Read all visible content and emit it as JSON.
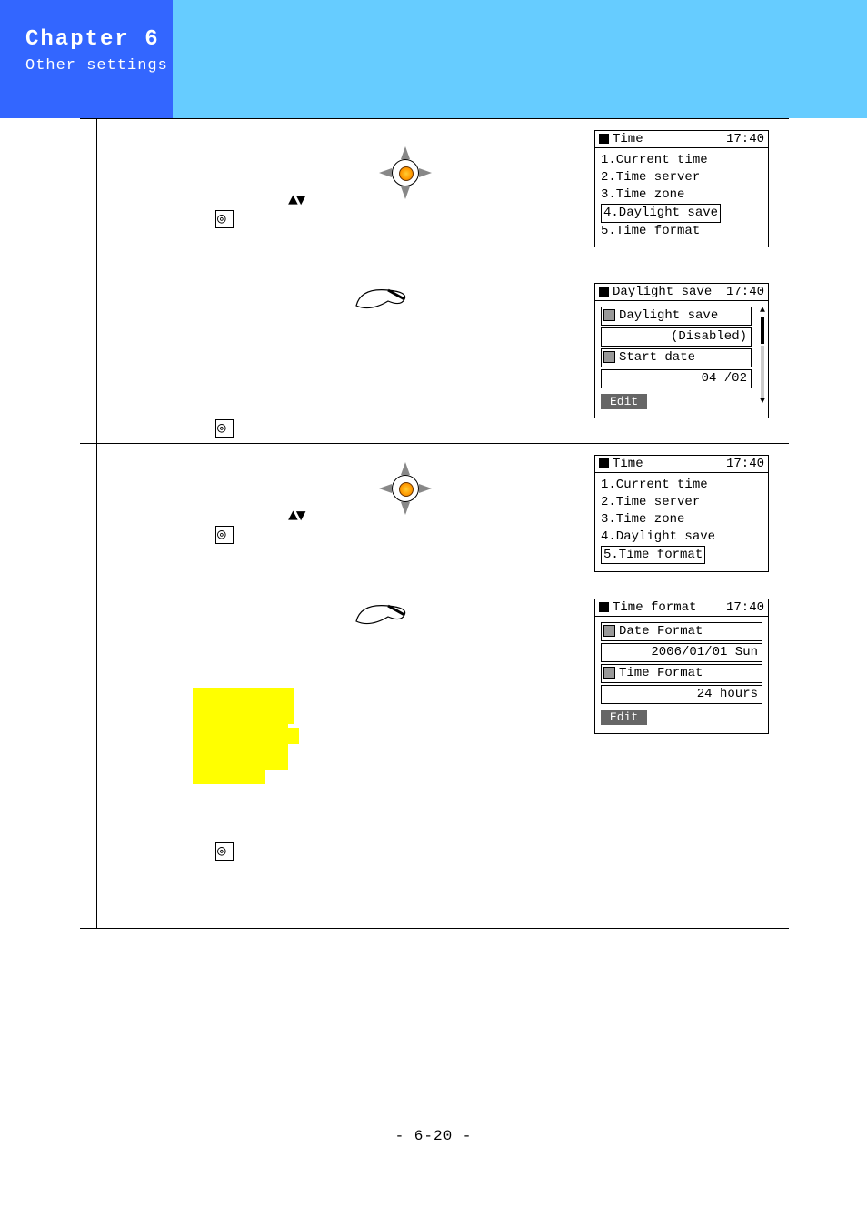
{
  "header": {
    "chapter": "Chapter 6",
    "subtitle": "Other settings"
  },
  "arrows_glyph": "▲▼",
  "section1": {
    "panel_time": {
      "title": "Time",
      "clock": "17:40",
      "items": [
        "1.Current time",
        "2.Time server",
        "3.Time zone",
        "4.Daylight save",
        "5.Time format"
      ],
      "highlighted_index": 3
    },
    "panel_daylight": {
      "title": "Daylight save",
      "clock": "17:40",
      "field1_label": "Daylight save",
      "field1_value": "(Disabled)",
      "field2_label": "Start date",
      "field2_value": "04 /02",
      "button": "Edit"
    }
  },
  "section2": {
    "panel_time": {
      "title": "Time",
      "clock": "17:40",
      "items": [
        "1.Current time",
        "2.Time server",
        "3.Time zone",
        "4.Daylight save",
        "5.Time format"
      ],
      "highlighted_index": 4
    },
    "panel_format": {
      "title": "Time format",
      "clock": "17:40",
      "field1_label": "Date Format",
      "field1_value": "2006/01/01 Sun",
      "field2_label": "Time Format",
      "field2_value": "24 hours",
      "button": "Edit"
    }
  },
  "page_number": "- 6-20 -"
}
